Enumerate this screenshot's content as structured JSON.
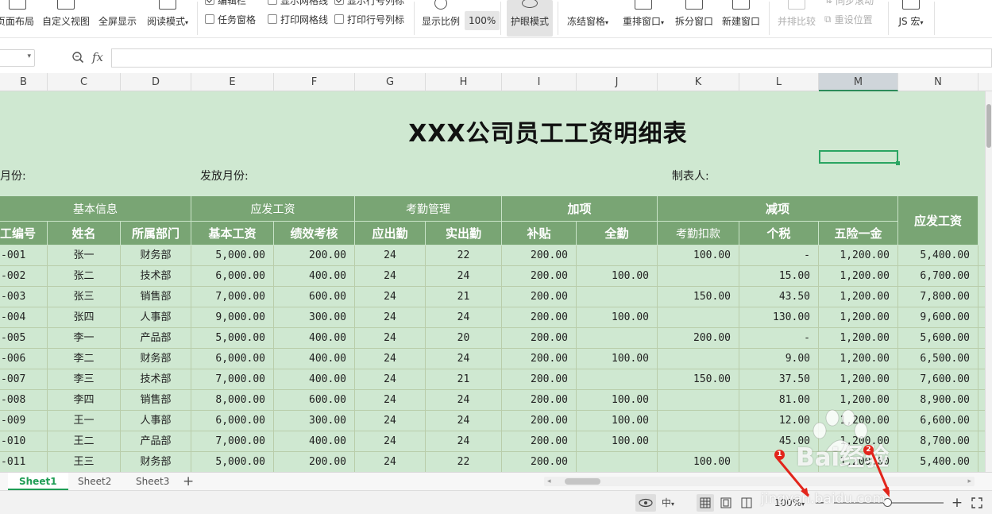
{
  "ribbon": {
    "buttons": [
      {
        "id": "page-layout",
        "label": "页面布局"
      },
      {
        "id": "custom-view",
        "label": "自定义视图"
      },
      {
        "id": "full-screen",
        "label": "全屏显示"
      },
      {
        "id": "reading-mode",
        "label": "阅读模式"
      },
      {
        "id": "zoom-ratio",
        "label": "显示比例"
      },
      {
        "id": "eye-protect",
        "label": "护眼模式"
      },
      {
        "id": "freeze-panes",
        "label": "冻结窗格"
      },
      {
        "id": "arrange-windows",
        "label": "重排窗口"
      },
      {
        "id": "split-window",
        "label": "拆分窗口"
      },
      {
        "id": "new-window",
        "label": "新建窗口"
      },
      {
        "id": "side-by-side",
        "label": "并排比较"
      },
      {
        "id": "reset-position",
        "label": "重设位置"
      },
      {
        "id": "sync-scroll",
        "label": "同步滚动"
      },
      {
        "id": "js-macro",
        "label": "JS 宏"
      }
    ],
    "zoom_100": "100%",
    "checks": {
      "edit_bar": {
        "label": "编辑栏",
        "checked": true
      },
      "task_pane": {
        "label": "任务窗格",
        "checked": false
      },
      "show_gridlines": {
        "label": "显示网格线",
        "checked": false
      },
      "print_gridlines": {
        "label": "打印网格线",
        "checked": false
      },
      "show_headers": {
        "label": "显示行号列标",
        "checked": true
      },
      "print_headers": {
        "label": "打印行号列标",
        "checked": false
      }
    }
  },
  "formula_bar": {
    "fx_label": "fx",
    "value": ""
  },
  "columns": [
    "B",
    "C",
    "D",
    "E",
    "F",
    "G",
    "H",
    "I",
    "J",
    "K",
    "L",
    "M",
    "N"
  ],
  "sheet": {
    "title": "XXX公司员工工资明细表",
    "info": {
      "month_label": "月份:",
      "pay_month_label": "发放月份:",
      "maker_label": "制表人:"
    },
    "group_headers": {
      "basic": "基本信息",
      "salary": "应发工资",
      "attendance": "考勤管理",
      "bonus": "加项",
      "deduction": "减项",
      "gross": "应发工资"
    },
    "sub_headers": {
      "emp_no": "工编号",
      "name": "姓名",
      "dept": "所属部门",
      "base": "基本工资",
      "perf": "绩效考核",
      "due": "应出勤",
      "actual": "实出勤",
      "subsidy": "补贴",
      "full": "全勤",
      "att_deduct": "考勤扣款",
      "tax": "个税",
      "insurance": "五险一金"
    },
    "rows": [
      {
        "id": "-001",
        "name": "张一",
        "dept": "财务部",
        "base": "5,000.00",
        "perf": "200.00",
        "due": "24",
        "actual": "22",
        "subsidy": "200.00",
        "full": "",
        "att": "100.00",
        "tax": "-",
        "ins": "1,200.00",
        "gross": "5,400.00"
      },
      {
        "id": "-002",
        "name": "张二",
        "dept": "技术部",
        "base": "6,000.00",
        "perf": "400.00",
        "due": "24",
        "actual": "24",
        "subsidy": "200.00",
        "full": "100.00",
        "att": "",
        "tax": "15.00",
        "ins": "1,200.00",
        "gross": "6,700.00"
      },
      {
        "id": "-003",
        "name": "张三",
        "dept": "销售部",
        "base": "7,000.00",
        "perf": "600.00",
        "due": "24",
        "actual": "21",
        "subsidy": "200.00",
        "full": "",
        "att": "150.00",
        "tax": "43.50",
        "ins": "1,200.00",
        "gross": "7,800.00"
      },
      {
        "id": "-004",
        "name": "张四",
        "dept": "人事部",
        "base": "9,000.00",
        "perf": "300.00",
        "due": "24",
        "actual": "24",
        "subsidy": "200.00",
        "full": "100.00",
        "att": "",
        "tax": "130.00",
        "ins": "1,200.00",
        "gross": "9,600.00"
      },
      {
        "id": "-005",
        "name": "李一",
        "dept": "产品部",
        "base": "5,000.00",
        "perf": "400.00",
        "due": "24",
        "actual": "20",
        "subsidy": "200.00",
        "full": "",
        "att": "200.00",
        "tax": "-",
        "ins": "1,200.00",
        "gross": "5,600.00"
      },
      {
        "id": "-006",
        "name": "李二",
        "dept": "财务部",
        "base": "6,000.00",
        "perf": "400.00",
        "due": "24",
        "actual": "24",
        "subsidy": "200.00",
        "full": "100.00",
        "att": "",
        "tax": "9.00",
        "ins": "1,200.00",
        "gross": "6,500.00"
      },
      {
        "id": "-007",
        "name": "李三",
        "dept": "技术部",
        "base": "7,000.00",
        "perf": "400.00",
        "due": "24",
        "actual": "21",
        "subsidy": "200.00",
        "full": "",
        "att": "150.00",
        "tax": "37.50",
        "ins": "1,200.00",
        "gross": "7,600.00"
      },
      {
        "id": "-008",
        "name": "李四",
        "dept": "销售部",
        "base": "8,000.00",
        "perf": "600.00",
        "due": "24",
        "actual": "24",
        "subsidy": "200.00",
        "full": "100.00",
        "att": "",
        "tax": "81.00",
        "ins": "1,200.00",
        "gross": "8,900.00"
      },
      {
        "id": "-009",
        "name": "王一",
        "dept": "人事部",
        "base": "6,000.00",
        "perf": "300.00",
        "due": "24",
        "actual": "24",
        "subsidy": "200.00",
        "full": "100.00",
        "att": "",
        "tax": "12.00",
        "ins": "1,200.00",
        "gross": "6,600.00"
      },
      {
        "id": "-010",
        "name": "王二",
        "dept": "产品部",
        "base": "7,000.00",
        "perf": "400.00",
        "due": "24",
        "actual": "24",
        "subsidy": "200.00",
        "full": "100.00",
        "att": "",
        "tax": "45.00",
        "ins": "1,200.00",
        "gross": "8,700.00"
      },
      {
        "id": "-011",
        "name": "王三",
        "dept": "财务部",
        "base": "5,000.00",
        "perf": "200.00",
        "due": "24",
        "actual": "22",
        "subsidy": "200.00",
        "full": "",
        "att": "100.00",
        "tax": "",
        "ins": "1,200.00",
        "gross": "5,400.00"
      }
    ]
  },
  "tabs": [
    "Sheet1",
    "Sheet2",
    "Sheet3"
  ],
  "status": {
    "zoom": "100%",
    "zoom_level_percent": 100,
    "minus": "−",
    "plus": "+"
  },
  "watermark": {
    "text": "Bai经验",
    "url": "jingyan.baidu.com",
    "badges": [
      "1",
      "2"
    ]
  },
  "colors": {
    "sheet_bg": "#cfe8d1",
    "header_bg": "#79a574",
    "accent": "#1f9d55"
  }
}
